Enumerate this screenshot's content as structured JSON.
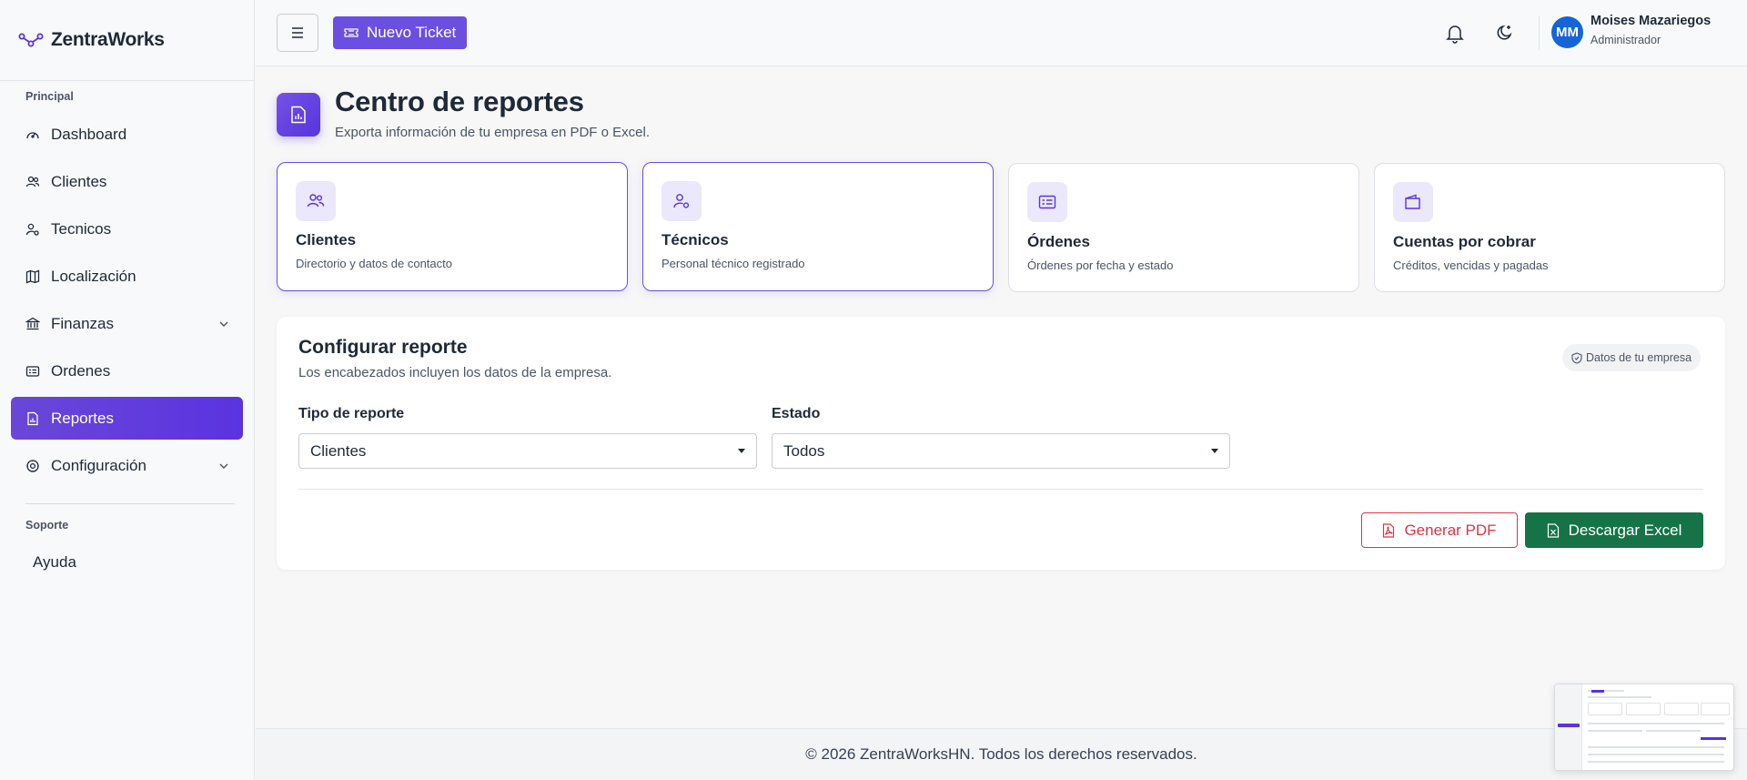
{
  "app": {
    "brand": "ZentraWorks"
  },
  "sidebar": {
    "principal_label": "Principal",
    "soporte_label": "Soporte",
    "items": [
      {
        "label": "Dashboard",
        "icon": "gauge-icon"
      },
      {
        "label": "Clientes",
        "icon": "users-icon"
      },
      {
        "label": "Tecnicos",
        "icon": "technician-icon"
      },
      {
        "label": "Localización",
        "icon": "map-icon"
      },
      {
        "label": "Finanzas",
        "icon": "bank-icon"
      },
      {
        "label": "Ordenes",
        "icon": "card-list-icon"
      },
      {
        "label": "Reportes",
        "icon": "report-icon",
        "active": true
      },
      {
        "label": "Configuración",
        "icon": "gear-icon"
      }
    ],
    "help_label": "Ayuda"
  },
  "header": {
    "new_ticket_label": "Nuevo Ticket",
    "user": {
      "initials": "MM",
      "name": "Moises Mazariegos",
      "role": "Administrador"
    }
  },
  "page": {
    "title": "Centro de reportes",
    "subtitle": "Exporta información de tu empresa en PDF o Excel."
  },
  "report_cards": [
    {
      "title": "Clientes",
      "description": "Directorio y datos de contacto",
      "icon": "users-icon",
      "selected": true
    },
    {
      "title": "Técnicos",
      "description": "Personal técnico registrado",
      "icon": "technician-icon",
      "selected": true
    },
    {
      "title": "Órdenes",
      "description": "Órdenes por fecha y estado",
      "icon": "card-list-icon",
      "selected": false
    },
    {
      "title": "Cuentas por cobrar",
      "description": "Créditos, vencidas y pagadas",
      "icon": "wallet-icon",
      "selected": false
    }
  ],
  "config": {
    "title": "Configurar reporte",
    "subtitle": "Los encabezados incluyen los datos de la empresa.",
    "badge": "Datos de tu empresa",
    "report_type_label": "Tipo de reporte",
    "report_type_value": "Clientes",
    "status_label": "Estado",
    "status_value": "Todos",
    "pdf_button": "Generar PDF",
    "excel_button": "Descargar Excel"
  },
  "footer": {
    "text": "© 2026 ZentraWorksHN. Todos los derechos reservados."
  },
  "colors": {
    "accent": "#5a33e0",
    "danger": "#dc3545",
    "success": "#157347",
    "avatar": "#1565d8"
  }
}
